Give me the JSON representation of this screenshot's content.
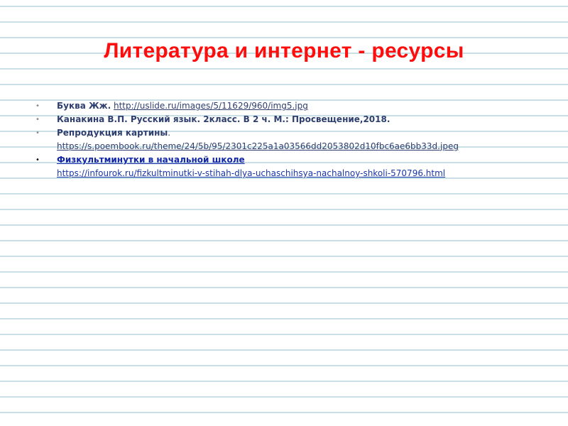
{
  "slide": {
    "title": "Литература и интернет - ресурсы",
    "title_color": "#ff0d0d",
    "rule_color": "#c8dfe6",
    "bullet_glyph": "•",
    "resources": [
      {
        "lead": "Буква Жж.",
        "url": "http://uslide.ru/images/5/11629/960/img5.jpg"
      },
      {
        "text": "Канакина В.П. Русский язык. 2класс. В 2 ч. М.: Просвещение,2018."
      },
      {
        "lead": "Репродукция картины",
        "punct": ".",
        "url": "https://s.poembook.ru/theme/24/5b/95/2301c225a1a03566dd2053802d10fbc6ae6bb33d.jpeg"
      },
      {
        "lead": "Физкультминутки в начальной школе",
        "url": "https://infourok.ru/fizkultminutki-v-stihah-dlya-uchaschihsya-nachalnoy-shkoli-570796.html"
      }
    ]
  }
}
